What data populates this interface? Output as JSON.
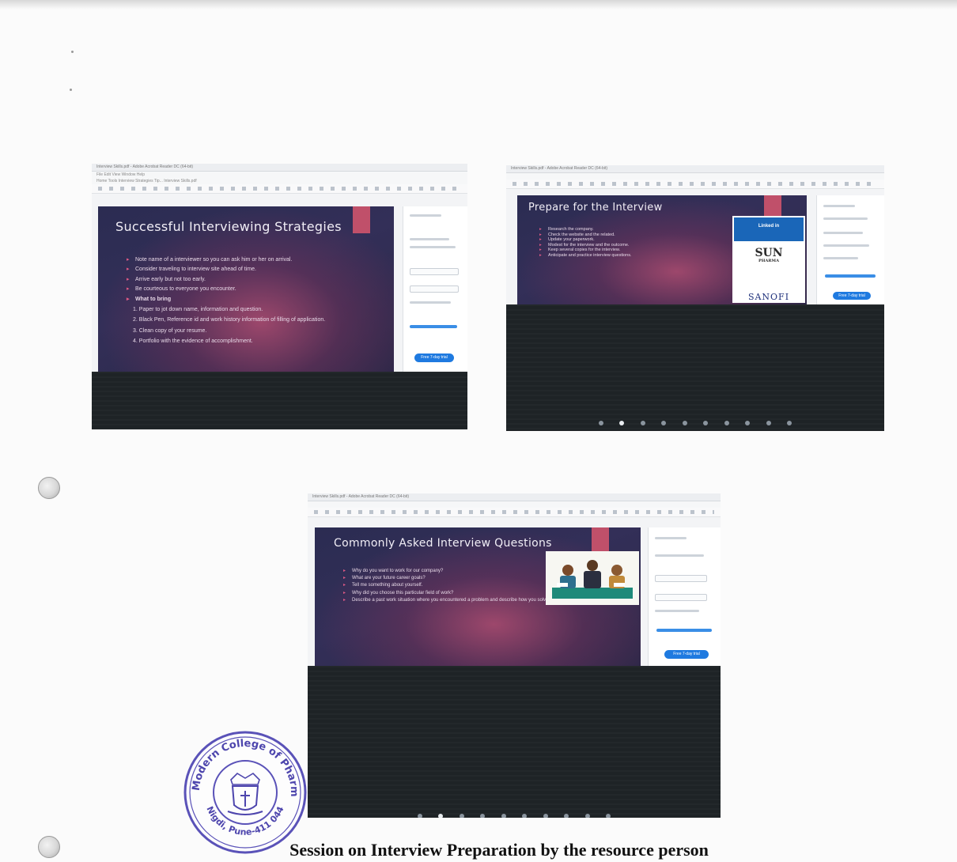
{
  "screenshot_1": {
    "window_title": "Interview Skills.pdf - Adobe Acrobat Reader DC (64-bit)",
    "menu": "File   Edit   View   Window   Help",
    "tabs": "Home   Tools   Interview Strategies Tip...   Interview Skills.pdf",
    "slide_title": "Successful Interviewing Strategies",
    "bullets": [
      "Note name of a interviewer so you can ask him or her on arrival.",
      "Consider traveling to interview site ahead of time.",
      "Arrive early but not too early.",
      "Be courteous to everyone you encounter.",
      "What to bring"
    ],
    "sub_items": [
      "1. Paper to jot down name, information and question.",
      "2. Black Pen, Reference id and work history information of filling of application.",
      "3. Clean copy of your resume.",
      "4. Portfolio with the evidence of accomplishment."
    ],
    "sidebar_button": "Free 7-day trial"
  },
  "screenshot_2": {
    "window_title": "Interview Skills.pdf - Adobe Acrobat Reader DC (64-bit)",
    "slide_title": "Prepare for the Interview",
    "bullets": [
      "Research the company.",
      "Check the website and the related.",
      "Update your paperwork.",
      "Modest for the interview and the outcome.",
      "Keep several copies for the interview.",
      "Anticipate and practice interview questions."
    ],
    "logos": {
      "linkedin": "Linked in",
      "sun": "SUN",
      "sun_sub": "PHARMA",
      "sanofi": "SANOFI"
    },
    "sidebar_button": "Free 7-day trial",
    "dot_count": 10,
    "active_dot": 1
  },
  "screenshot_3": {
    "window_title": "Interview Skills.pdf - Adobe Acrobat Reader DC (64-bit)",
    "slide_title": "Commonly Asked Interview Questions",
    "bullets": [
      "Why do you want to work for our company?",
      "What are your future career goals?",
      "Tell me something about yourself.",
      "Why did you choose this particular field of work?",
      "Describe a past work situation where you encountered a problem and describe how you solved it."
    ],
    "sidebar_button": "Free 7-day trial",
    "dot_count": 10,
    "active_dot": 1
  },
  "stamp": {
    "outer_text": "PES Modern College of Pharmacy",
    "bottom_text": "Nigdi, Pune-411 044"
  },
  "caption": "Session on Interview Preparation by the resource person"
}
